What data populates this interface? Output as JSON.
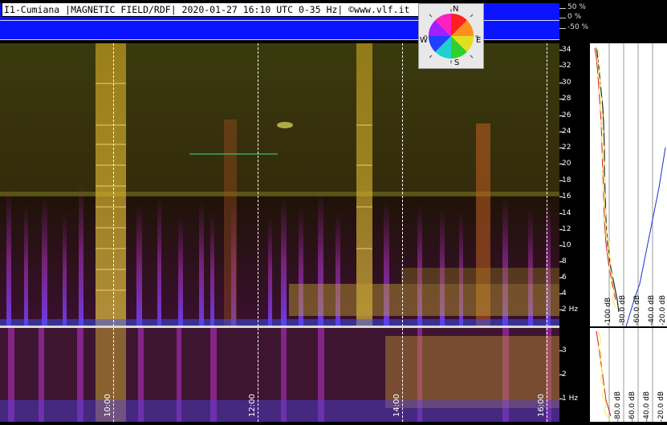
{
  "header": {
    "title": "I1-Cumiana |MAGNETIC FIELD/RDF| 2020-01-27 16:10 UTC 0-35 Hz| ©www.vlf.it"
  },
  "polarization_axis": [
    "50 %",
    "0 %",
    "-50 %"
  ],
  "compass": {
    "n": "N",
    "e": "E",
    "s": "S",
    "w": "W"
  },
  "time_axis": [
    "10:00",
    "12:00",
    "14:00",
    "16:00"
  ],
  "freq_axis_top": [
    "34",
    "32",
    "30",
    "28",
    "26",
    "24",
    "22",
    "20",
    "18",
    "16",
    "14",
    "12",
    "10",
    "8",
    "6",
    "4",
    "2 Hz"
  ],
  "freq_axis_bottom": [
    "3",
    "2",
    "1 Hz"
  ],
  "db_axis_top": [
    "-100 dB",
    "-80.0 dB",
    "-60.0 dB",
    "-40.0 dB",
    "-20.0 dB"
  ],
  "db_axis_bottom": [
    "-80.0 dB",
    "-60.0 dB",
    "-40.0 dB",
    "-20.0 dB"
  ],
  "colors": {
    "band_blue": "#0b14ff",
    "spectrum_yellow": "#fff080",
    "spectrum_red": "#d01818",
    "noise_blue": "#2030d0"
  }
}
